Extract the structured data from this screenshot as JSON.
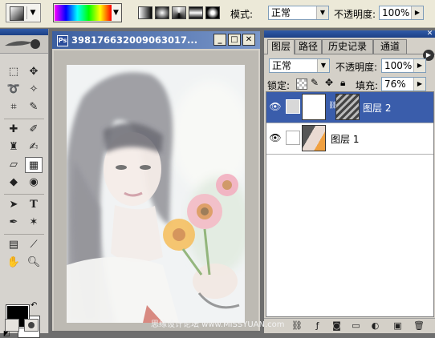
{
  "options_bar": {
    "mode_label": "模式:",
    "mode_value": "正常",
    "opacity_label": "不透明度:",
    "opacity_value": "100%"
  },
  "document": {
    "title": "398176632009063017..."
  },
  "panel": {
    "tabs": [
      "图层",
      "路径",
      "历史记录",
      "通道"
    ],
    "blend_mode": "正常",
    "opacity_label": "不透明度:",
    "opacity_value": "100%",
    "lock_label": "锁定:",
    "fill_label": "填充:",
    "fill_value": "76%",
    "layers": [
      {
        "name": "图层 2",
        "selected": true
      },
      {
        "name": "图层 1",
        "selected": false
      }
    ]
  },
  "watermark": "思缘设计论坛 www.MISSYUAN.com",
  "colors": {
    "foreground": "#000000",
    "background": "#ffffff",
    "selection": "#3a5dab"
  }
}
